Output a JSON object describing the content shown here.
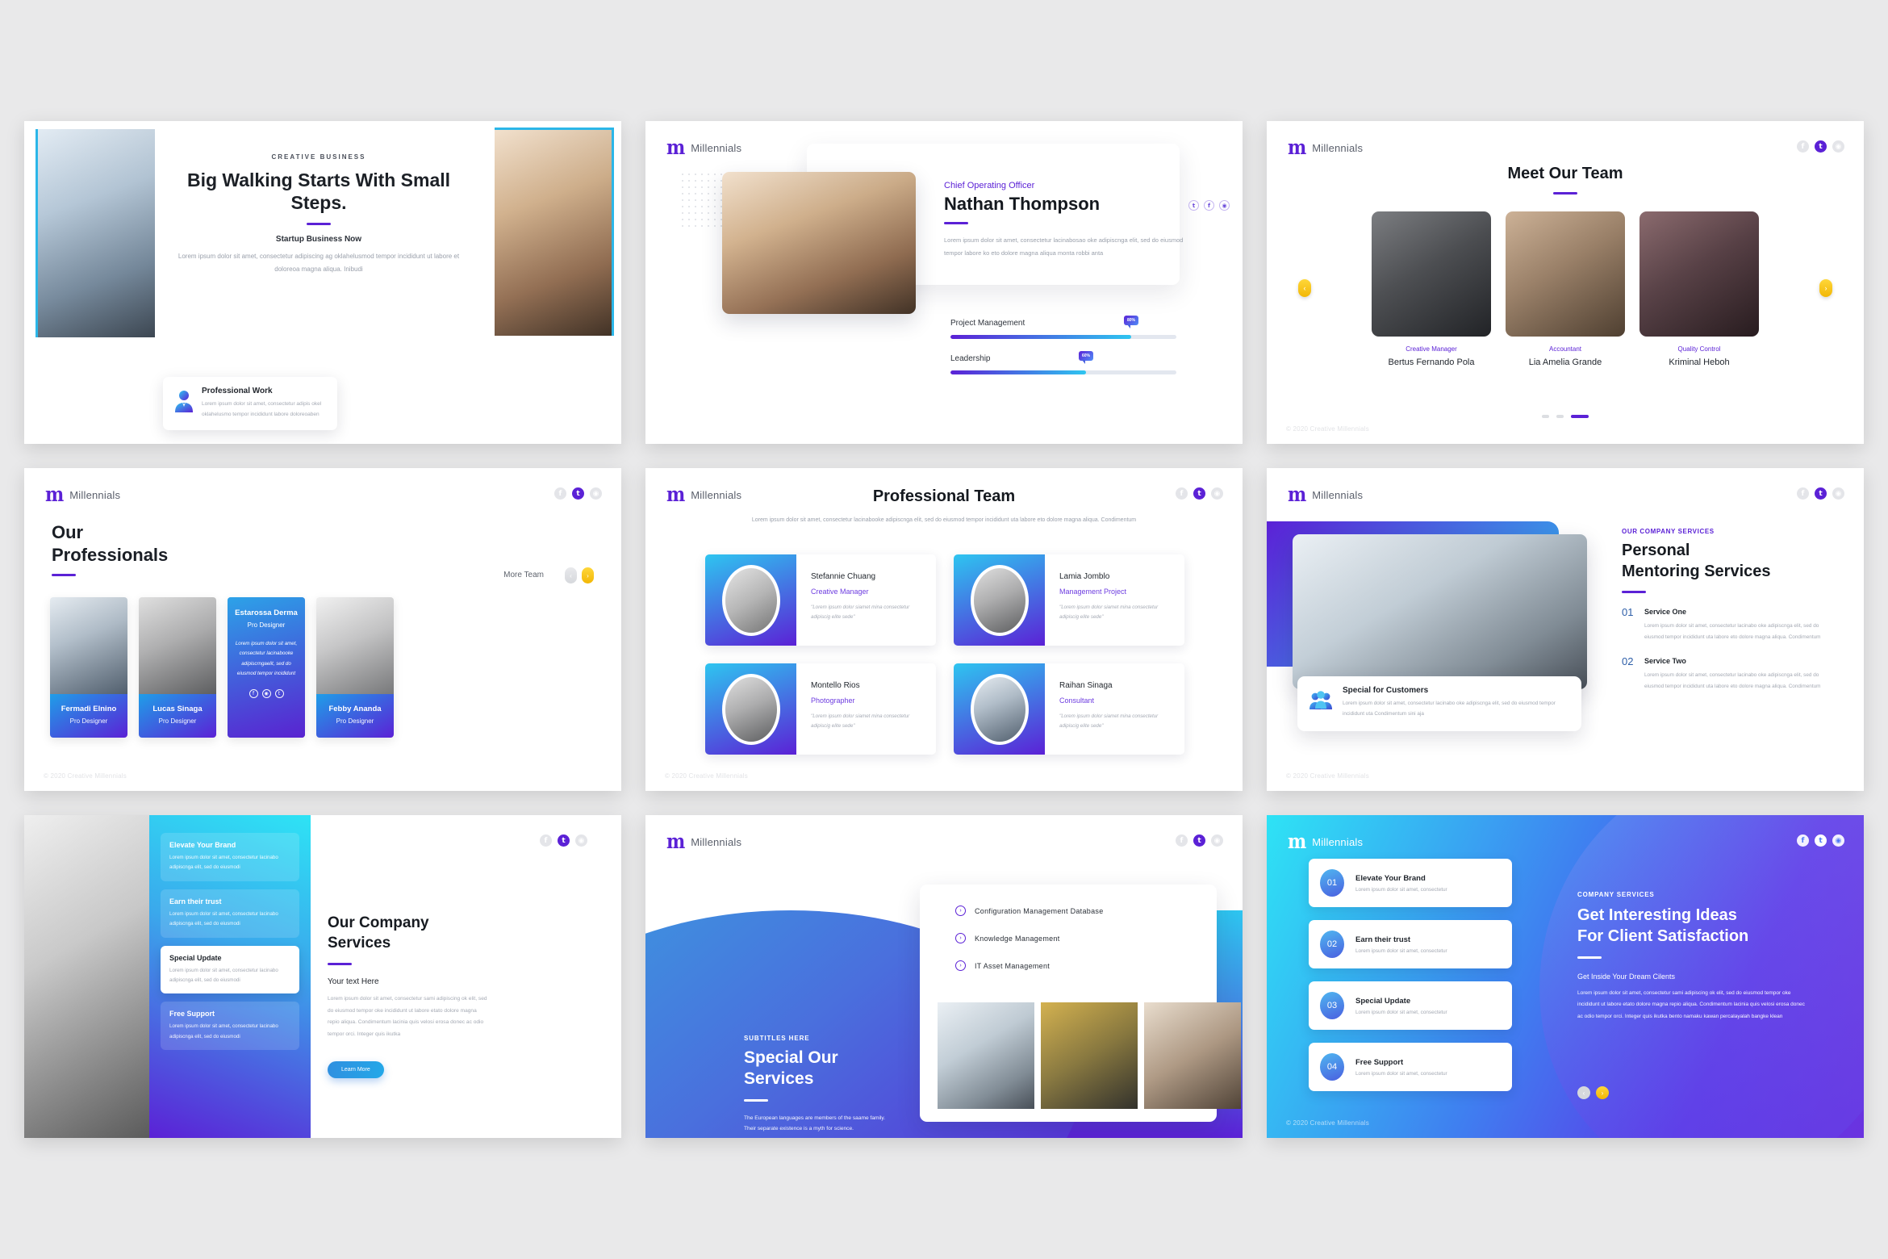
{
  "brand": {
    "name": "Millennials",
    "logo_glyph": "m",
    "accent": "#5b21d6",
    "cyan": "#2ec5f0",
    "yellow": "#f2b705"
  },
  "footer": {
    "copyright": "© 2020 Creative Millennials"
  },
  "socials": [
    {
      "name": "facebook-icon",
      "glyph": "f",
      "state": "muted"
    },
    {
      "name": "twitter-icon",
      "glyph": "t",
      "state": "active"
    },
    {
      "name": "instagram-icon",
      "glyph": "◉",
      "state": "muted"
    }
  ],
  "slides": [
    {
      "id": "hero",
      "eyebrow": "CREATIVE BUSINESS",
      "title": "Big Walking Starts With Small Steps.",
      "subtitle": "Startup Business Now",
      "body": "Lorem ipsum dolor sit amet, consectetur adipiscing ag oklahelusmod tempor incididunt ut labore et doloreoa magna aliqua. Inibudi",
      "card": {
        "title": "Professional Work",
        "body": "Lorem ipsum dolor sit amet, consectetur adipis okel oklahelusmo tempor incididunt labore doloreoaben",
        "icon": "person-tie-icon"
      }
    },
    {
      "id": "profile",
      "role": "Chief Operating Officer",
      "name": "Nathan Thompson",
      "body": "Lorem ipsum dolor sit amet, consectetur lacinabosao oke adipiscnga elit, sed do eiusmod tempor labore ko eto dolore magna aliqua monta robbi anta",
      "card_socials": [
        {
          "name": "twitter-icon",
          "glyph": "t"
        },
        {
          "name": "facebook-icon",
          "glyph": "f"
        },
        {
          "name": "instagram-icon",
          "glyph": "◉"
        }
      ],
      "skills": [
        {
          "label": "Project Management",
          "value": 80,
          "badge": "80%"
        },
        {
          "label": "Leadership",
          "value": 60,
          "badge": "60%"
        }
      ]
    },
    {
      "id": "meet-team",
      "title": "Meet Our Team",
      "members": [
        {
          "role": "Creative Manager",
          "name": "Bertus Fernando Pola",
          "photo": "ph-dark"
        },
        {
          "role": "Accountant",
          "name": "Lia Amelia Grande",
          "photo": "ph-tan"
        },
        {
          "role": "Quality Control",
          "name": "Kriminal Heboh",
          "photo": "ph-maroon"
        }
      ],
      "prev_label": "‹",
      "next_label": "›",
      "pager": {
        "count": 3,
        "active_index": 2
      }
    },
    {
      "id": "our-professionals",
      "title_line1": "Our",
      "title_line2": "Professionals",
      "more_label": "More Team",
      "prev_label": "‹",
      "next_label": "›",
      "cards": [
        {
          "name": "Fermadi Elnino",
          "role": "Pro Designer",
          "photo": "ph-tunnel",
          "active": false
        },
        {
          "name": "Lucas Sinaga",
          "role": "Pro Designer",
          "photo": "ph-grey",
          "active": false
        },
        {
          "name": "Estarossa Derma",
          "role": "Pro Designer",
          "photo": "ph-blueman",
          "active": true,
          "quote": "Lorem ipsum dolor sit amet, consectetur lacinabooke adipiscrngaelit, sed do eiusmod tempor incididunt",
          "socials": [
            {
              "name": "facebook-icon",
              "glyph": "f"
            },
            {
              "name": "instagram-icon",
              "glyph": "◉"
            },
            {
              "name": "twitter-icon",
              "glyph": "t"
            }
          ]
        },
        {
          "name": "Febby Ananda",
          "role": "Pro Designer",
          "photo": "ph-white",
          "active": false
        }
      ]
    },
    {
      "id": "professional-team",
      "title": "Professional Team",
      "lead": "Lorem ipsum dolor sit amet, consectetur lacinabooke adipiscnga elit, sed do eiusmod tempor incididunt uta labore eto dolore magna aliqua. Condimentum",
      "members": [
        {
          "name": "Stefannie Chuang",
          "role": "Creative Manager",
          "quote": "\"Lorem ipsum dolor siamet mina consectetur adipiscig elite sede\"",
          "photo": "ph-studio"
        },
        {
          "name": "Lamia Jomblo",
          "role": "Management Project",
          "quote": "\"Lorem ipsum dolor siamet mina consectetur adipiscig elite sede\"",
          "photo": "ph-grey"
        },
        {
          "name": "Montello Rios",
          "role": "Photographer",
          "quote": "\"Lorem ipsum dolor siamet mina consectetur adipiscig elite sede\"",
          "photo": "ph-grey"
        },
        {
          "name": "Raihan Sinaga",
          "role": "Consultant",
          "quote": "\"Lorem ipsum dolor siamet mina consectetur adipiscig elite sede\"",
          "photo": "ph-tunnel"
        }
      ]
    },
    {
      "id": "mentoring",
      "eyebrow": "OUR COMPANY SERVICES",
      "title_line1": "Personal",
      "title_line2": "Mentoring Services",
      "photo": "ph-meet",
      "card": {
        "title": "Special for Customers",
        "body": "Lorem ipsum dolor sit amet, consectetur lacinabo oke adipiscnga elit, sed do eiusmod tempor incididunt uta Condimentum sini aja",
        "icon": "users-group-icon"
      },
      "services": [
        {
          "num": "01",
          "title": "Service One",
          "body": "Lorem ipsum dolor sit amet, consectetur lacinabo oke adipiscnga elit, sed do eiusmod tempor incididunt uta labore eto dolore magna aliqua. Condimentum"
        },
        {
          "num": "02",
          "title": "Service Two",
          "body": "Lorem ipsum dolor sit amet, consectetur lacinabo oke adipiscnga elit, sed do eiusmod tempor incididunt uta labore eto dolore magna aliqua. Condimentum"
        }
      ]
    },
    {
      "id": "company-services",
      "photo": "ph-wall",
      "items": [
        {
          "title": "Elevate Your Brand",
          "body": "Lorem ipsum dolor sit amet, consectetur lacinabo adipiscnga elit, sed do eiusmodi",
          "highlight": false
        },
        {
          "title": "Earn their trust",
          "body": "Lorem ipsum dolor sit amet, consectetur lacinabo adipiscnga elit, sed do eiusmodi",
          "highlight": false
        },
        {
          "title": "Special Update",
          "body": "Lorem ipsum dolor sit amet, consectetur lacinabo adipiscnga elit, sed do eiusmodi",
          "highlight": true
        },
        {
          "title": "Free Support",
          "body": "Lorem ipsum dolor sit amet, consectetur lacinabo adipiscnga elit, sed do eiusmodi",
          "highlight": false
        }
      ],
      "title_line1": "Our Company",
      "title_line2": "Services",
      "subtitle": "Your text Here",
      "body": "Lorem ipsum dolor sit amet, consectetur sami adipiscing ok elit, sed do eiusmod tempor oke incididunt ut labore etato dolore magna repio aliqua. Condimentum lacinia quis velosi erosa donec ac odio tempor orci. Integer quis ikutka",
      "button": "Learn More"
    },
    {
      "id": "special-services",
      "eyebrow": "SUBTITLES HERE",
      "title_line1": "Special Our",
      "title_line2": "Services",
      "body": "The European languages are members of the saame family. Their separate existence is a myth for science.",
      "services": [
        "Configuration Management Database",
        "Knowledge Management",
        "IT Asset Management"
      ],
      "thumbs": [
        "ph-meet",
        "ph-sofa",
        "ph-stage"
      ]
    },
    {
      "id": "interesting-ideas",
      "rows": [
        {
          "num": "01",
          "title": "Elevate Your Brand",
          "body": "Lorem ipsum dolor sit amet, consectetur"
        },
        {
          "num": "02",
          "title": "Earn their trust",
          "body": "Lorem ipsum dolor sit amet, consectetur"
        },
        {
          "num": "03",
          "title": "Special Update",
          "body": "Lorem ipsum dolor sit amet, consectetur"
        },
        {
          "num": "04",
          "title": "Free Support",
          "body": "Lorem ipsum dolor sit amet, consectetur"
        }
      ],
      "eyebrow": "COMPANY SERVICES",
      "title_line1": "Get Interesting Ideas",
      "title_line2": "For Client Satisfaction",
      "subtitle": "Get Inside Your Dream Cilents",
      "body": "Lorem ipsum dolor sit amet, consectetur sami adipiscing ok elit, sed do eiusmod tempor oke incididunt ut labore etato dolore magna repio aliqua. Condimentum lacinia quis velosi erosa donec ac odio tempor orci. Integer quis ikutka bento namaku kawan percalayalah bangke klean",
      "prev_label": "‹",
      "next_label": "›"
    }
  ]
}
